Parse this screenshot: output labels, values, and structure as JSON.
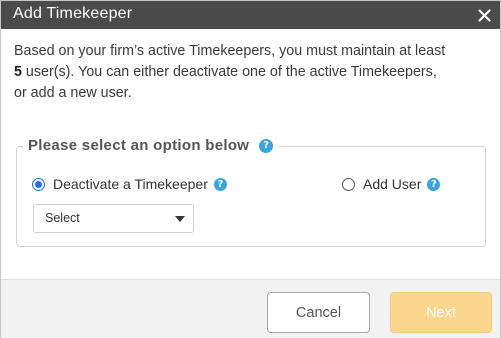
{
  "dialog": {
    "title": "Add Timekeeper",
    "close_icon": "close-icon"
  },
  "message": {
    "line1": "Based on your firm’s active Timekeepers, you must maintain at least",
    "count": "5",
    "line2_rest": " user(s). You can either deactivate one of the active Timekeepers,",
    "line3": "or add a new user."
  },
  "options": {
    "legend": "Please select an option below",
    "deactivate": {
      "label": "Deactivate a Timekeeper",
      "selected": true
    },
    "add_user": {
      "label": "Add User",
      "selected": false
    },
    "select": {
      "value": "Select"
    }
  },
  "footer": {
    "cancel_label": "Cancel",
    "next_label": "Next"
  },
  "colors": {
    "titlebar": "#4b4b4b",
    "help": "#3aa3dc",
    "radio_selected": "#1a73e8",
    "next_disabled": "#fad68e"
  }
}
